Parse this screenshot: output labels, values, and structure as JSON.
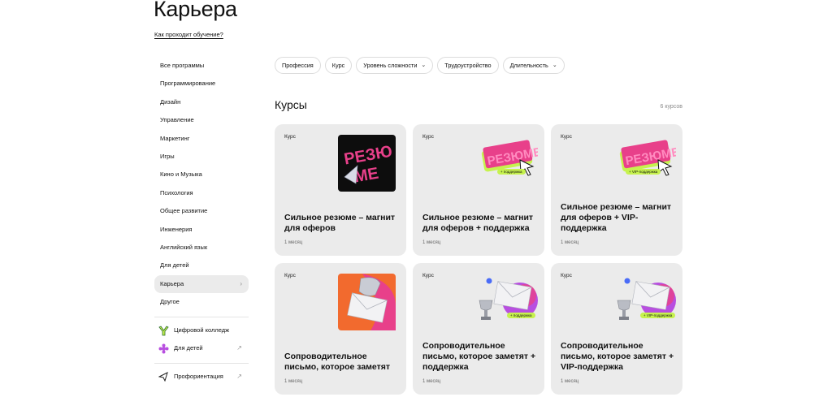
{
  "header": {
    "title": "Карьера",
    "how_link": "Как проходит обучение?"
  },
  "sidebar": {
    "items": [
      {
        "label": "Все программы"
      },
      {
        "label": "Программирование"
      },
      {
        "label": "Дизайн"
      },
      {
        "label": "Управление"
      },
      {
        "label": "Маркетинг"
      },
      {
        "label": "Игры"
      },
      {
        "label": "Кино и Музыка"
      },
      {
        "label": "Психология"
      },
      {
        "label": "Общее развитие"
      },
      {
        "label": "Инженерия"
      },
      {
        "label": "Английский язык"
      },
      {
        "label": "Для детей"
      },
      {
        "label": "Карьера",
        "active": true
      },
      {
        "label": "Другое"
      }
    ],
    "links": [
      {
        "label": "Цифровой колледж",
        "icon": "college-icon"
      },
      {
        "label": "Для детей",
        "icon": "kids-icon"
      },
      {
        "label": "Профориентация",
        "icon": "paper-plane-icon"
      }
    ]
  },
  "filters": {
    "items": [
      {
        "label": "Профессия",
        "dropdown": false
      },
      {
        "label": "Курс",
        "dropdown": false
      },
      {
        "label": "Уровень сложности",
        "dropdown": true
      },
      {
        "label": "Трудоустройство",
        "dropdown": false
      },
      {
        "label": "Длительность",
        "dropdown": true
      }
    ]
  },
  "courses": {
    "title": "Курсы",
    "count": "6 курсов",
    "cards": [
      {
        "badge": "Курс",
        "title": "Сильное резюме – магнит для оферов",
        "duration": "1 месяц",
        "art": "resume-black"
      },
      {
        "badge": "Курс",
        "title": "Сильное резюме – магнит для оферов + поддержка",
        "duration": "1 месяц",
        "art": "resume-sticker",
        "sticker": "+ поддержка"
      },
      {
        "badge": "Курс",
        "title": "Сильное резюме – магнит для оферов + VIP-поддержка",
        "duration": "1 месяц",
        "art": "resume-sticker",
        "sticker": "+ VIP-поддержка"
      },
      {
        "badge": "Курс",
        "title": "Сопроводительное письмо, которое заметят",
        "duration": "1 месяц",
        "art": "letter-orange"
      },
      {
        "badge": "Курс",
        "title": "Сопроводительное письмо, которое заметят + поддержка",
        "duration": "1 месяц",
        "art": "letter-trophy",
        "sticker": "+ поддержка"
      },
      {
        "badge": "Курс",
        "title": "Сопроводительное письмо, которое заметят + VIP-поддержка",
        "duration": "1 месяц",
        "art": "letter-trophy",
        "sticker": "+ VIP-поддержка"
      }
    ]
  },
  "colors": {
    "accent_pink": "#e8408a",
    "accent_lime": "#c6f24e",
    "accent_orange": "#f26a2e",
    "card_bg": "#ebebeb"
  },
  "art_text": {
    "resume_word": "РЕЗЮМЕ"
  }
}
